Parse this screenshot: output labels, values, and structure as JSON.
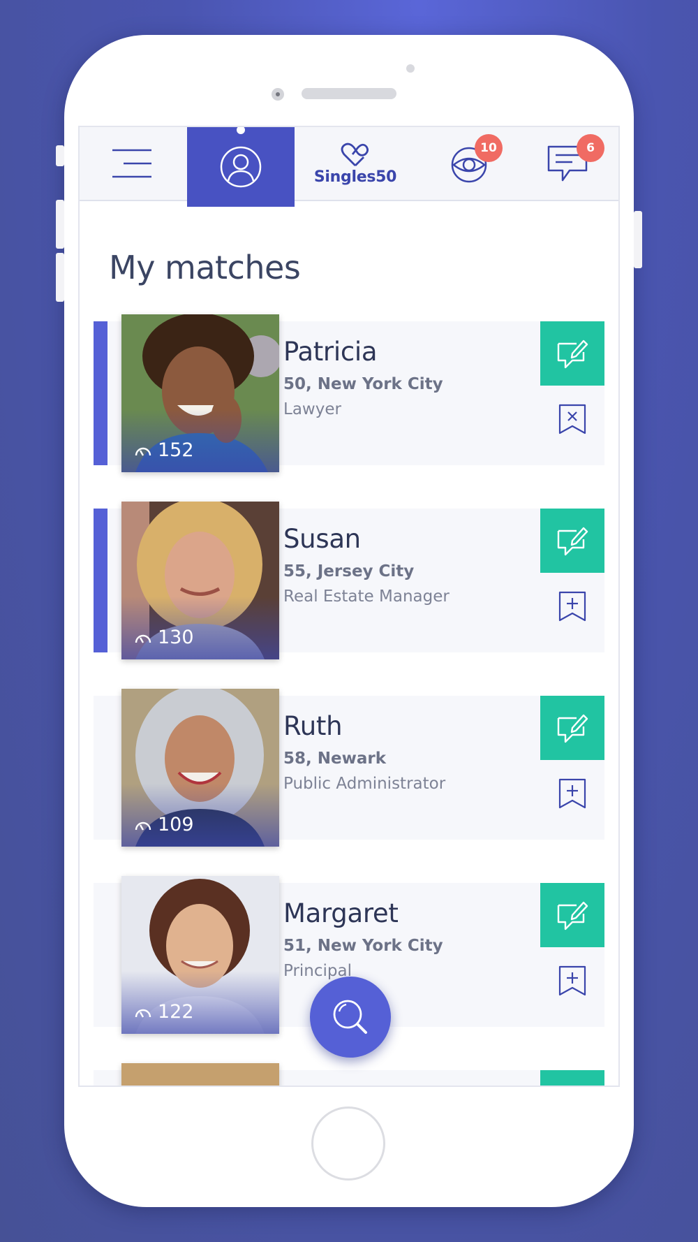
{
  "app": {
    "brand": "Singles50",
    "colors": {
      "background": "#4a55b0",
      "accent": "#4852c2",
      "action": "#21c4a2",
      "badge": "#f06b63"
    }
  },
  "nav": {
    "menu_icon": "hamburger-menu-icon",
    "profile_icon": "user-profile-icon",
    "logo_icon": "heart-infinity-logo-icon",
    "views_icon": "eye-icon",
    "views_badge": "10",
    "messages_icon": "chat-bubble-icon",
    "messages_badge": "6"
  },
  "page": {
    "title": "My matches"
  },
  "matches": [
    {
      "name": "Patricia",
      "meta": "50, New York City",
      "job": "Lawyer",
      "score": "152",
      "bookmark": "bookmark-remove-icon"
    },
    {
      "name": "Susan",
      "meta": "55, Jersey City",
      "job": "Real Estate Manager",
      "score": "130",
      "bookmark": "bookmark-add-icon"
    },
    {
      "name": "Ruth",
      "meta": "58, Newark",
      "job": "Public Administrator",
      "score": "109",
      "bookmark": "bookmark-add-icon"
    },
    {
      "name": "Margaret",
      "meta": "51, New York City",
      "job": "Principal",
      "score": "122",
      "bookmark": "bookmark-add-icon"
    }
  ],
  "fab": {
    "icon": "search-icon"
  }
}
